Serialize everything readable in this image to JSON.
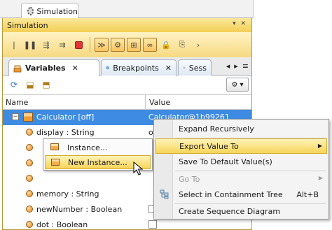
{
  "outer_tab": {
    "label": "Simulation"
  },
  "panel": {
    "title": "Simulation"
  },
  "tabs": {
    "variables": "Variables",
    "breakpoints": "Breakpoints",
    "sessions": "Sess"
  },
  "table": {
    "header_name": "Name",
    "header_value": "Value",
    "rows": [
      {
        "name": "Calculator [off]",
        "value": "Calculator@1b99261"
      },
      {
        "name": "display : String",
        "value": "of"
      },
      {
        "name": "",
        "value": ""
      },
      {
        "name": "",
        "value": ""
      },
      {
        "name": "",
        "value": ""
      },
      {
        "name": "memory : String",
        "value": ""
      },
      {
        "name": "newNumber : Boolean",
        "value": ""
      },
      {
        "name": "dot : Boolean",
        "value": ""
      }
    ]
  },
  "instance_menu": {
    "items": [
      "Instance...",
      "New Instance..."
    ]
  },
  "context_menu": {
    "expand": "Expand Recursively",
    "export": "Export Value To",
    "save_default": "Save To Default Value(s)",
    "goto": "Go To",
    "select_tree": "Select in Containment Tree",
    "select_tree_shortcut": "Alt+B",
    "create_seq": "Create Sequence Diagram"
  },
  "colors": {
    "accent_yellow": "#f7d45a",
    "selection_blue": "#3d8be3",
    "panel_title_gold": "#f4cf55"
  }
}
